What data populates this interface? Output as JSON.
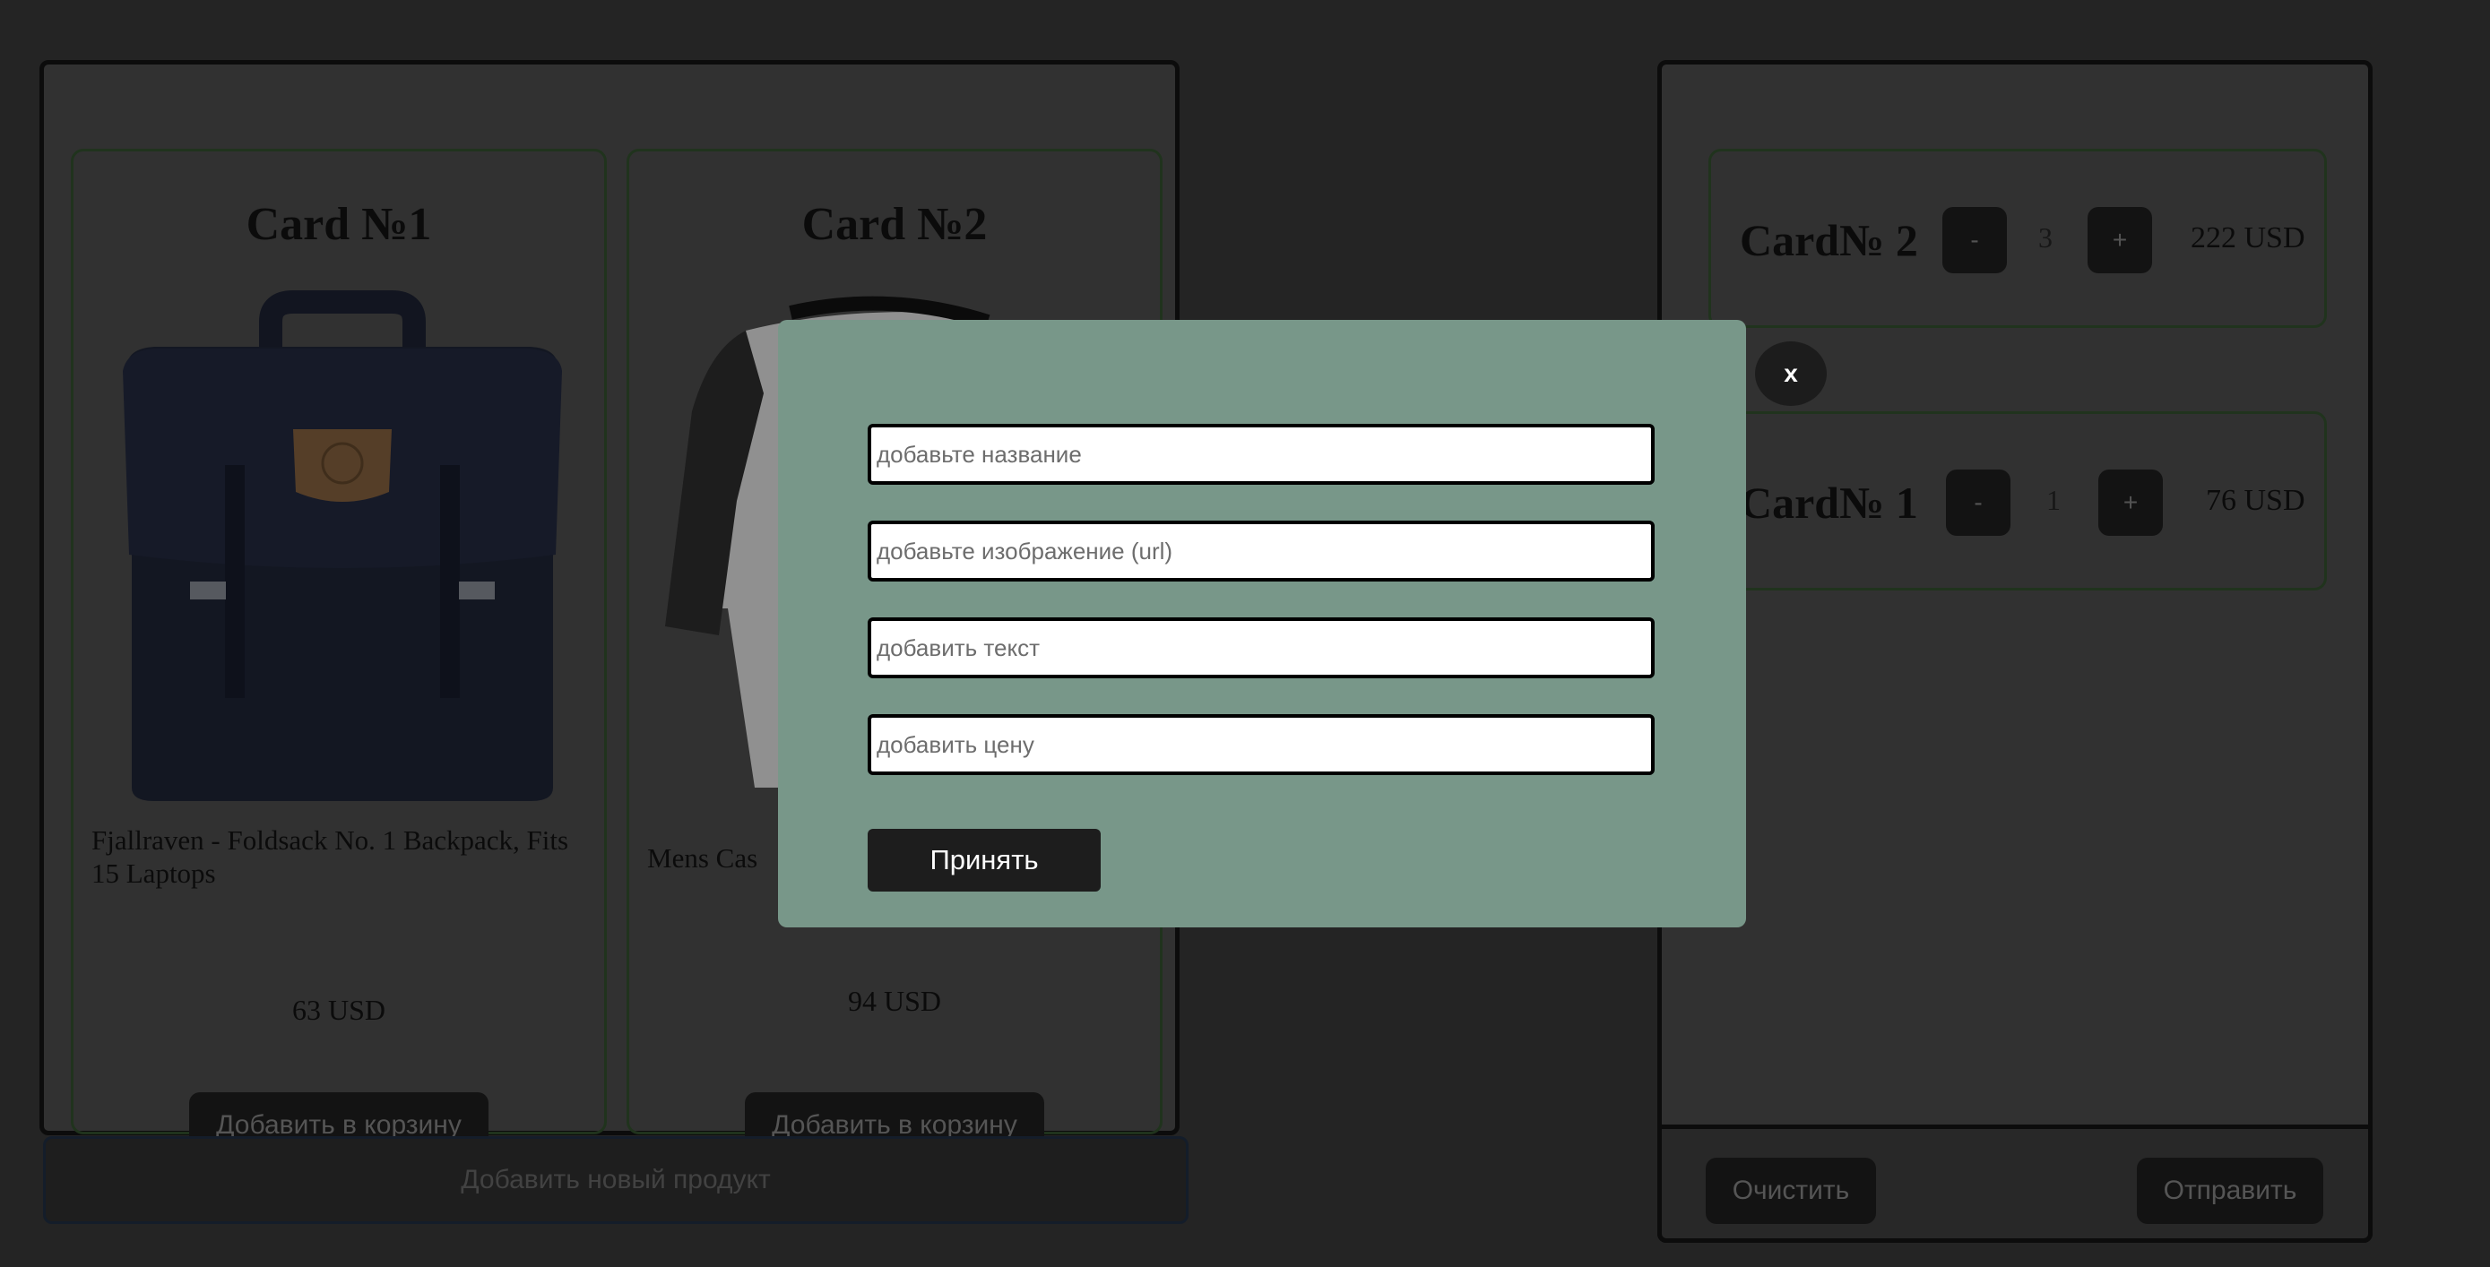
{
  "products": [
    {
      "title": "Card №1",
      "description": "Fjallraven - Foldsack No. 1 Backpack, Fits 15 Laptops",
      "price": "63 USD",
      "add_label": "Добавить в корзину",
      "image": "backpack"
    },
    {
      "title": "Card №2",
      "description": "Mens Cas",
      "price": "94 USD",
      "add_label": "Добавить в корзину",
      "image": "raglan-shirt"
    }
  ],
  "add_product_label": "Добавить новый продукт",
  "cart": {
    "items": [
      {
        "name": "Card№ 2",
        "minus": "-",
        "qty": "3",
        "plus": "+",
        "price": "222 USD"
      },
      {
        "name": "Card№ 1",
        "minus": "-",
        "qty": "1",
        "plus": "+",
        "price": "76 USD"
      }
    ],
    "clear_label": "Очистить",
    "send_label": "Отправить"
  },
  "modal": {
    "close_label": "x",
    "fields": {
      "name_placeholder": "добавьте название",
      "image_placeholder": "добавьте изображение (url)",
      "text_placeholder": "добавить текст",
      "price_placeholder": "добавить цену"
    },
    "accept_label": "Принять"
  },
  "colors": {
    "page_bg": "#343434",
    "modal_bg": "#789789",
    "card_border": "#2f4a2a"
  }
}
